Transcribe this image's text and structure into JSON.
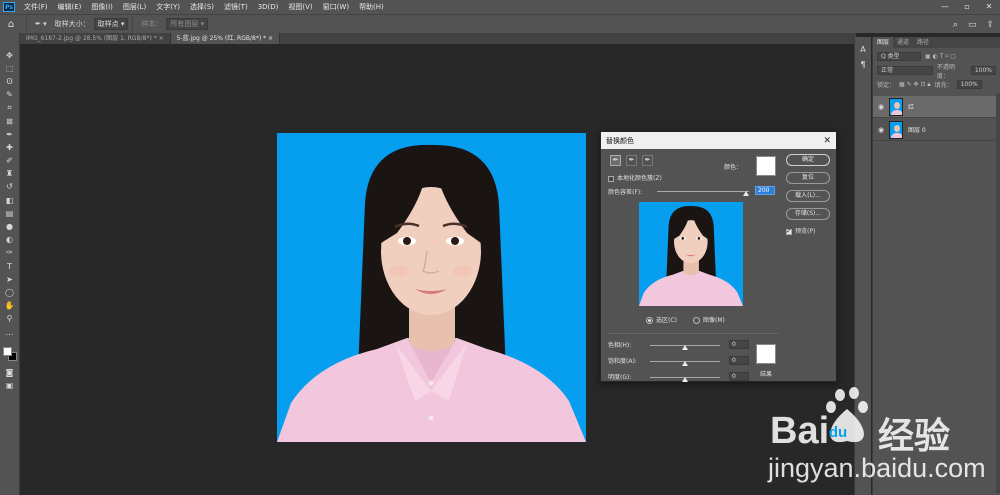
{
  "menubar": {
    "logo": "Ps",
    "items": [
      "文件(F)",
      "编辑(E)",
      "图像(I)",
      "图层(L)",
      "文字(Y)",
      "选择(S)",
      "滤镜(T)",
      "3D(D)",
      "视图(V)",
      "窗口(W)",
      "帮助(H)"
    ],
    "window_controls": [
      "—",
      "▫",
      "✕"
    ]
  },
  "options": {
    "sample_size_label": "取样大小：",
    "sample_size_value": "取样点",
    "sample_label": "样本：",
    "sample_value": "所有图层"
  },
  "tabs": [
    {
      "label": "IMG_6187-2.jpg @ 28.5% (图层 1, RGB/8*) *  ×"
    },
    {
      "label": "5-蓝.jpg @ 25% (红, RGB/8*) *  ×"
    }
  ],
  "layers_panel": {
    "tabs": [
      "图层",
      "通道",
      "路径"
    ],
    "kind_label": "Q 类型",
    "blend_mode": "正常",
    "opacity_label": "不透明度：",
    "opacity_value": "100%",
    "lock_label": "锁定：",
    "fill_label": "填充：",
    "fill_value": "100%",
    "layers": [
      {
        "name": "红"
      },
      {
        "name": "图层 0"
      }
    ]
  },
  "dialog": {
    "title": "替换颜色",
    "close": "✕",
    "localized_label": "本地化颜色簇(Z)",
    "color_label": "颜色：",
    "fuzziness_label": "颜色容差(F):",
    "fuzziness_value": "200",
    "fuzziness_level": 1.0,
    "buttons": {
      "ok": "确定",
      "reset": "复位",
      "load": "载入(L)...",
      "save": "存储(S)..."
    },
    "preview_label": "预览(P)",
    "preview_checked": true,
    "radio_selection": "选区(C)",
    "radio_image": "图像(M)",
    "hue_label": "色相(H):",
    "hue_value": "0",
    "saturation_label": "饱和度(A):",
    "saturation_value": "0",
    "lightness_label": "明度(G):",
    "lightness_value": "0",
    "result_label": "结果"
  },
  "watermark": {
    "brand_cn": "经验",
    "url": "jingyan.baidu.com"
  },
  "colors": {
    "photo_background": "#069fef",
    "shirt": "#f2c7dd",
    "accent": "#31a8ff"
  }
}
